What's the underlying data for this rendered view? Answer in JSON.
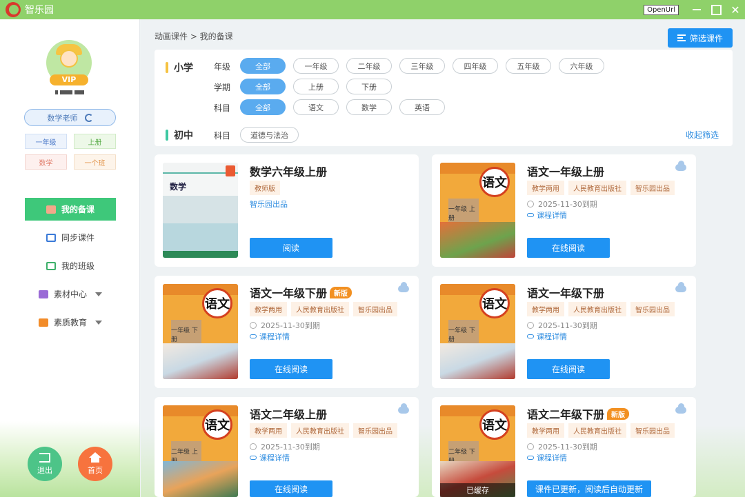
{
  "app": {
    "title": "智乐园",
    "openurl_label": "OpenUrl",
    "minimize_label": "",
    "close_label": "✕"
  },
  "sidebar": {
    "vip_label": "VIP",
    "role_button": "数学老师",
    "tags": [
      {
        "label": "一年级",
        "color": "#4a78c8"
      },
      {
        "label": "上册",
        "color": "#5cad4c"
      },
      {
        "label": "数学",
        "color": "#e07c6a"
      },
      {
        "label": "一个班",
        "color": "#e2964e"
      }
    ],
    "nav": [
      {
        "label": "我的备课",
        "active": true,
        "icon": "book-icon"
      },
      {
        "label": "同步课件",
        "active": false,
        "icon": "courseware-icon"
      },
      {
        "label": "我的班级",
        "active": false,
        "icon": "class-icon"
      },
      {
        "label": "素材中心",
        "active": false,
        "icon": "cube-icon",
        "expandable": true
      },
      {
        "label": "素质教育",
        "active": false,
        "icon": "tv-icon",
        "expandable": true
      }
    ],
    "exit_label": "退出",
    "home_label": "首页"
  },
  "main": {
    "breadcrumb": "动画课件 > 我的备课",
    "filter_button": "筛选课件",
    "collapse_label": "收起筛选",
    "primary": {
      "label": "小学",
      "accent": "#f5c242",
      "rows": [
        {
          "label": "年级",
          "options": [
            "全部",
            "一年级",
            "二年级",
            "三年级",
            "四年级",
            "五年级",
            "六年级"
          ],
          "selected": "全部"
        },
        {
          "label": "学期",
          "options": [
            "全部",
            "上册",
            "下册"
          ],
          "selected": "全部"
        },
        {
          "label": "科目",
          "options": [
            "全部",
            "语文",
            "数学",
            "英语"
          ],
          "selected": "全部"
        }
      ]
    },
    "middle": {
      "label": "初中",
      "accent": "#3ec8a2",
      "rows": [
        {
          "label": "科目",
          "options": [
            "道德与法治"
          ],
          "selected": ""
        }
      ]
    },
    "cards": [
      {
        "title": "数学六年级上册",
        "is_new": false,
        "tags": [
          "教师版"
        ],
        "publisher_link": "智乐园出品",
        "expiry": "",
        "details_link": "",
        "button": "阅读",
        "cover": "math",
        "cover_text": "数学",
        "cloud": false,
        "cached": ""
      },
      {
        "title": "语文一年级上册",
        "is_new": false,
        "tags": [
          "教学两用",
          "人民教育出版社",
          "智乐园出品"
        ],
        "publisher_link": "",
        "expiry": "2025-11-30到期",
        "details_link": "课程详情",
        "button": "在线阅读",
        "cover": "chinese",
        "cover_char": "语文",
        "cover_grade": "一年级\n上册",
        "cloud": true,
        "cached": ""
      },
      {
        "title": "语文一年级下册",
        "is_new": true,
        "new_label": "新版",
        "tags": [
          "教学两用",
          "人民教育出版社",
          "智乐园出品"
        ],
        "publisher_link": "",
        "expiry": "2025-11-30到期",
        "details_link": "课程详情",
        "button": "在线阅读",
        "cover": "chinese",
        "cover_char": "语文",
        "cover_grade": "一年级\n下册",
        "cloud": true,
        "cached": ""
      },
      {
        "title": "语文一年级下册",
        "is_new": false,
        "tags": [
          "教学两用",
          "人民教育出版社",
          "智乐园出品"
        ],
        "publisher_link": "",
        "expiry": "2025-11-30到期",
        "details_link": "课程详情",
        "button": "在线阅读",
        "cover": "chinese",
        "cover_char": "语文",
        "cover_grade": "一年级\n下册",
        "cloud": true,
        "cached": ""
      },
      {
        "title": "语文二年级上册",
        "is_new": false,
        "tags": [
          "教学两用",
          "人民教育出版社",
          "智乐园出品"
        ],
        "publisher_link": "",
        "expiry": "2025-11-30到期",
        "details_link": "课程详情",
        "button": "在线阅读",
        "cover": "chinese",
        "cover_char": "语文",
        "cover_grade": "二年级\n上册",
        "cloud": true,
        "cached": ""
      },
      {
        "title": "语文二年级下册",
        "is_new": true,
        "new_label": "新版",
        "tags": [
          "教学两用",
          "人民教育出版社",
          "智乐园出品"
        ],
        "publisher_link": "",
        "expiry": "2025-11-30到期",
        "details_link": "课程详情",
        "button": "课件已更新，阅读后自动更新",
        "cover": "chinese",
        "cover_char": "语文",
        "cover_grade": "二年级\n下册",
        "cloud": true,
        "cached": "已缓存"
      }
    ]
  }
}
